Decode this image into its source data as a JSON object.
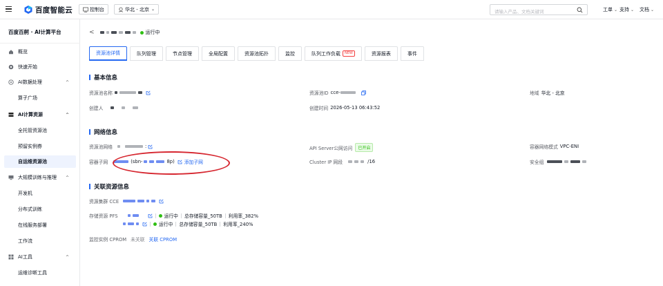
{
  "topbar": {
    "brand": "百度智能云",
    "console": "控制台",
    "region": "华北 - 北京",
    "search_placeholder": "请输入产品、文档关键词",
    "menu": [
      "工单",
      "支持",
      "文档"
    ]
  },
  "sidebar": {
    "title": "百度百舸 · AI计算平台",
    "items": [
      {
        "label": "概览",
        "icon": "home-icon"
      },
      {
        "label": "快速开始",
        "icon": "rocket-icon"
      },
      {
        "label": "AI数据处理",
        "icon": "data-icon"
      },
      {
        "label": "算子广场"
      },
      {
        "label": "AI计算资源",
        "icon": "server-icon"
      },
      {
        "label": "全托管资源池"
      },
      {
        "label": "预留实例券"
      },
      {
        "label": "自运维资源池"
      },
      {
        "label": "大规模训练与推理",
        "icon": "monitor-icon"
      },
      {
        "label": "开发机"
      },
      {
        "label": "分布式训练"
      },
      {
        "label": "在线服务部署"
      },
      {
        "label": "工作流"
      },
      {
        "label": "AI工具",
        "icon": "grid-icon"
      },
      {
        "label": "运维诊断工具"
      }
    ]
  },
  "header": {
    "status": "运行中"
  },
  "tabs": [
    "资源池详情",
    "队列管理",
    "节点管理",
    "全局配置",
    "资源池拓扑",
    "监控",
    "队列工作负载",
    "资源报表",
    "事件"
  ],
  "new_badge": "NEW",
  "basic": {
    "title": "基本信息",
    "name_label": "资源池名称",
    "id_label": "资源池ID",
    "id_prefix": "cce-",
    "region_label": "地域",
    "region_value": "华北 - 北京",
    "creator_label": "创建人",
    "created_label": "创建时间",
    "created_value": "2026-05-13 06:43:52"
  },
  "network": {
    "title": "网络信息",
    "vpc_label": "资源池网络",
    "vpc_suffix": ":",
    "api_label": "API Server公网访问",
    "api_value": "已开启",
    "mode_label": "容器网络模式",
    "mode_value": "VPC-ENI",
    "subnet_label": "容器子网",
    "subnet_mid": "(sbn-",
    "subnet_end": "8p)",
    "add_subnet": "添加子网",
    "cluster_ip_label": "Cluster IP 网段",
    "cluster_ip_suffix": "/16",
    "sg_label": "安全组"
  },
  "related": {
    "title": "关联资源信息",
    "cce_label": "资源集群 CCE",
    "pfs_label": "存储资源 PFS",
    "pfs_rows": [
      {
        "status": "运行中",
        "capacity": "总存储容量_50TB",
        "usage": "利用率_382%"
      },
      {
        "status": "运行中",
        "capacity": "总存储容量_50TB",
        "usage": "利用率_240%"
      }
    ],
    "cprom_label": "监控实例 CPROM",
    "cprom_value": "未关联",
    "cprom_link": "关联 CPROM"
  }
}
